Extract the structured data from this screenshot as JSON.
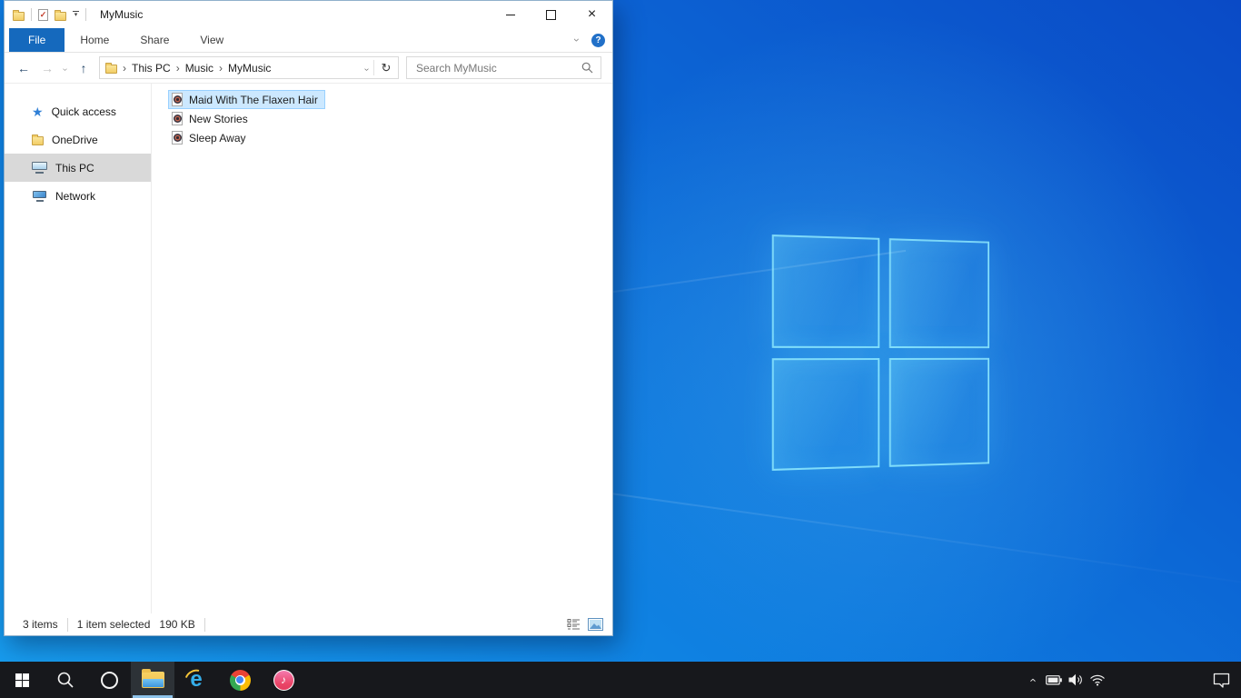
{
  "titlebar": {
    "title": "MyMusic"
  },
  "ribbon": {
    "tabs": [
      {
        "label": "File",
        "active": true
      },
      {
        "label": "Home",
        "active": false
      },
      {
        "label": "Share",
        "active": false
      },
      {
        "label": "View",
        "active": false
      }
    ],
    "help_glyph": "?"
  },
  "navbar": {
    "breadcrumb": [
      "This PC",
      "Music",
      "MyMusic"
    ],
    "search_placeholder": "Search MyMusic"
  },
  "sidebar": {
    "items": [
      {
        "label": "Quick access",
        "icon": "star-icon",
        "selected": false
      },
      {
        "label": "OneDrive",
        "icon": "folder-icon",
        "selected": false
      },
      {
        "label": "This PC",
        "icon": "monitor-icon",
        "selected": true
      },
      {
        "label": "Network",
        "icon": "network-icon",
        "selected": false
      }
    ]
  },
  "files": [
    {
      "name": "Maid With The Flaxen Hair",
      "type": "audio",
      "selected": true
    },
    {
      "name": "New Stories",
      "type": "audio",
      "selected": false
    },
    {
      "name": "Sleep Away",
      "type": "audio",
      "selected": false
    }
  ],
  "status": {
    "count": "3 items",
    "selection": "1 item selected",
    "size": "190 KB"
  },
  "glyphs": {
    "back": "←",
    "forward": "→",
    "up": "↑",
    "chevron": "›",
    "refresh": "↻",
    "dropdown": "▾",
    "star": "★",
    "close": "×",
    "check": "✓",
    "note": "♪",
    "ie": "e"
  },
  "colors": {
    "accent": "#1569bd",
    "selection_bg": "#cce8ff",
    "selection_border": "#99d1ff",
    "sidebar_selected": "#d9d9d9",
    "taskbar": "#17181c",
    "taskbar_underline": "#8ec3ea",
    "wallpaper_bright": "#189dee",
    "wallpaper_dark": "#0a4ac6"
  }
}
